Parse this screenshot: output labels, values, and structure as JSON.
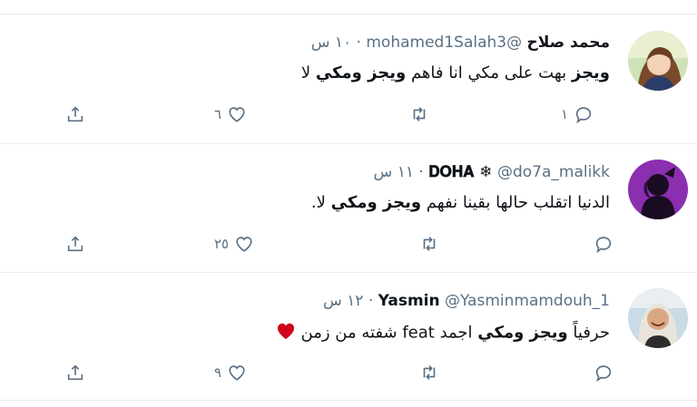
{
  "tweets": [
    {
      "name": "محمد صلاح",
      "handle": "@mohamed1Salah3",
      "dot": "·",
      "time": "١٠ س",
      "text_pre": "ويجز",
      "text_mid": " بهت على مكي انا فاهم ",
      "text_bold2": "ويجز ومكي",
      "text_post": " لا",
      "replies": "١",
      "retweets": "",
      "likes": "٦"
    },
    {
      "name": "𝐃𝐎𝐇𝐀 ❄",
      "handle": "@do7a_malikk",
      "dot": "·",
      "time": "١١ س",
      "text_pre": "الدنيا اتقلب حالها بقينا نفهم ",
      "text_bold": "ويجز ومكي",
      "text_post": " لا.",
      "replies": "",
      "retweets": "",
      "likes": "٢٥"
    },
    {
      "name": "Yasmin",
      "handle": "@Yasminmamdouh_1",
      "dot": "·",
      "time": "١٢ س",
      "text_pre": "حرفياً ",
      "text_bold": "ويجز ومكي",
      "text_post": " اجمد feat شفته من زمن",
      "emoji": "heart-emoji",
      "replies": "",
      "retweets": "",
      "likes": "٩"
    }
  ],
  "colors": {
    "muted": "#5b7083",
    "separator": "#e6ecf0",
    "heart_emoji": "#d0021b"
  }
}
